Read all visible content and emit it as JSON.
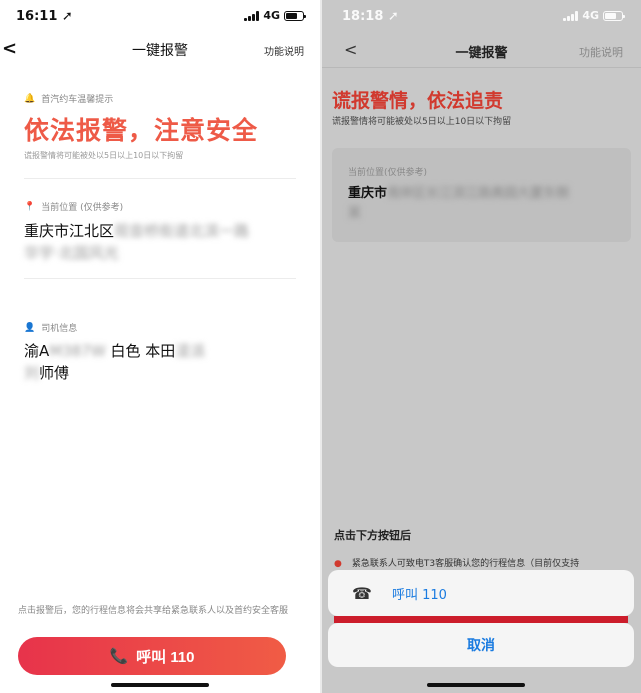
{
  "left": {
    "status": {
      "time": "16:11 ➚",
      "network": "4G"
    },
    "nav": {
      "back": "<",
      "title": "一键报警",
      "help": "功能说明"
    },
    "tip": {
      "label": "首汽约车温馨提示",
      "headline": "依法报警，注意安全",
      "warning": "谎报警情将可能被处以5日以上10日以下拘留"
    },
    "location": {
      "label": "当前位置 (仅供参考)",
      "address_visible": "重庆市江北区",
      "address_blurred_1": "观音桥街道北滨一路",
      "address_blurred_2": "华宇·北国风光"
    },
    "driver": {
      "label": "司机信息",
      "plate_prefix": "渝A",
      "plate_blurred": "M387W",
      "car_info": "白色 本田",
      "car_blurred": "凌派",
      "name_blurred": "刘",
      "name_suffix": "师傅"
    },
    "footer_note": "点击报警后，您的行程信息将会共享给紧急联系人以及首约安全客服",
    "call_button": {
      "icon": "📞",
      "label": "呼叫 110"
    }
  },
  "right": {
    "status": {
      "time": "18:18 ➚",
      "network": "4G"
    },
    "nav": {
      "back": "<",
      "title": "一键报警",
      "help": "功能说明"
    },
    "headline": "谎报警情，依法追责",
    "warning": "谎报警情将可能被处以5日以上10日以下拘留",
    "location": {
      "label": "当前位置(仅供参考)",
      "address_visible": "重庆市",
      "address_blurred_1": "南岸区长江滨江路奥园大厦东侧",
      "address_blurred_2": "某"
    },
    "after_title": "点击下方按钮后",
    "bullet": "紧急联系人可致电T3客服确认您的行程信息（目前仅支持",
    "sheet": {
      "call_label": "呼叫 110",
      "cancel_label": "取消"
    }
  }
}
